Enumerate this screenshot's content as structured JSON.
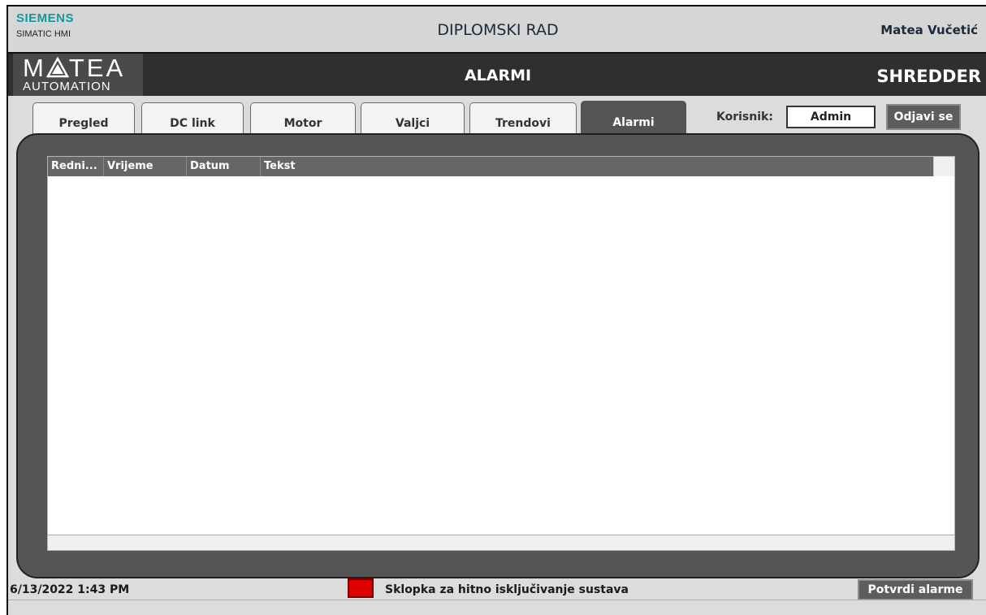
{
  "header": {
    "brand": "SIEMENS",
    "product": "SIMATIC HMI",
    "project_title": "DIPLOMSKI RAD",
    "author": "Matea Vučetić"
  },
  "banner": {
    "logo_top": "MÅTEA",
    "logo_bottom": "AUTOMATION",
    "screen_title": "ALARMI",
    "machine": "SHREDDER"
  },
  "tabs": [
    {
      "label": "Pregled",
      "active": false
    },
    {
      "label": "DC link",
      "active": false
    },
    {
      "label": "Motor",
      "active": false
    },
    {
      "label": "Valjci",
      "active": false
    },
    {
      "label": "Trendovi",
      "active": false
    },
    {
      "label": "Alarmi",
      "active": true
    }
  ],
  "user": {
    "label": "Korisnik:",
    "value": "Admin",
    "logout_label": "Odjavi se"
  },
  "alarm_table": {
    "columns": [
      "Redni...",
      "Vrijeme",
      "Datum",
      "Tekst"
    ],
    "rows": []
  },
  "status": {
    "datetime": "6/13/2022 1:43 PM",
    "estop_label": "Sklopka za hitno isključivanje sustava",
    "estop_color": "#e10000",
    "ack_label": "Potvrdi alarme"
  }
}
